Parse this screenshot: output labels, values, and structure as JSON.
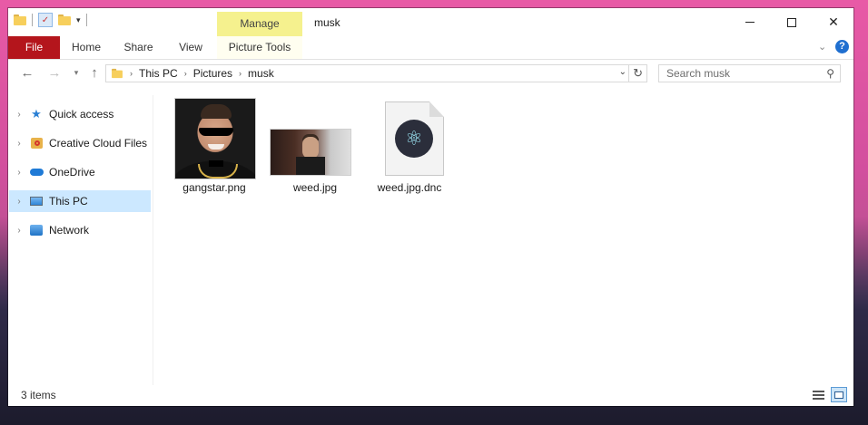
{
  "window": {
    "title": "musk",
    "contextual_group": "Manage"
  },
  "quick_access_toolbar": {
    "icons": [
      "folder-icon",
      "properties-icon",
      "new-folder-icon",
      "customize-dropdown-icon"
    ]
  },
  "ribbon": {
    "tabs": [
      {
        "label": "File"
      },
      {
        "label": "Home"
      },
      {
        "label": "Share"
      },
      {
        "label": "View"
      },
      {
        "label": "Picture Tools"
      }
    ],
    "file_tab_color": "#b4151c",
    "manage_color": "#f5f18e"
  },
  "address_bar": {
    "crumbs": [
      "This PC",
      "Pictures",
      "musk"
    ]
  },
  "search": {
    "placeholder": "Search musk"
  },
  "sidebar": {
    "items": [
      {
        "label": "Quick access",
        "icon": "star-icon"
      },
      {
        "label": "Creative Cloud Files",
        "icon": "creative-cloud-icon"
      },
      {
        "label": "OneDrive",
        "icon": "cloud-icon"
      },
      {
        "label": "This PC",
        "icon": "computer-icon",
        "selected": true
      },
      {
        "label": "Network",
        "icon": "network-icon"
      }
    ],
    "selected_color": "#cce8ff"
  },
  "files": [
    {
      "name": "gangstar.png",
      "type": "image"
    },
    {
      "name": "weed.jpg",
      "type": "image"
    },
    {
      "name": "weed.jpg.dnc",
      "type": "document"
    }
  ],
  "status": {
    "item_count": "3 items"
  }
}
